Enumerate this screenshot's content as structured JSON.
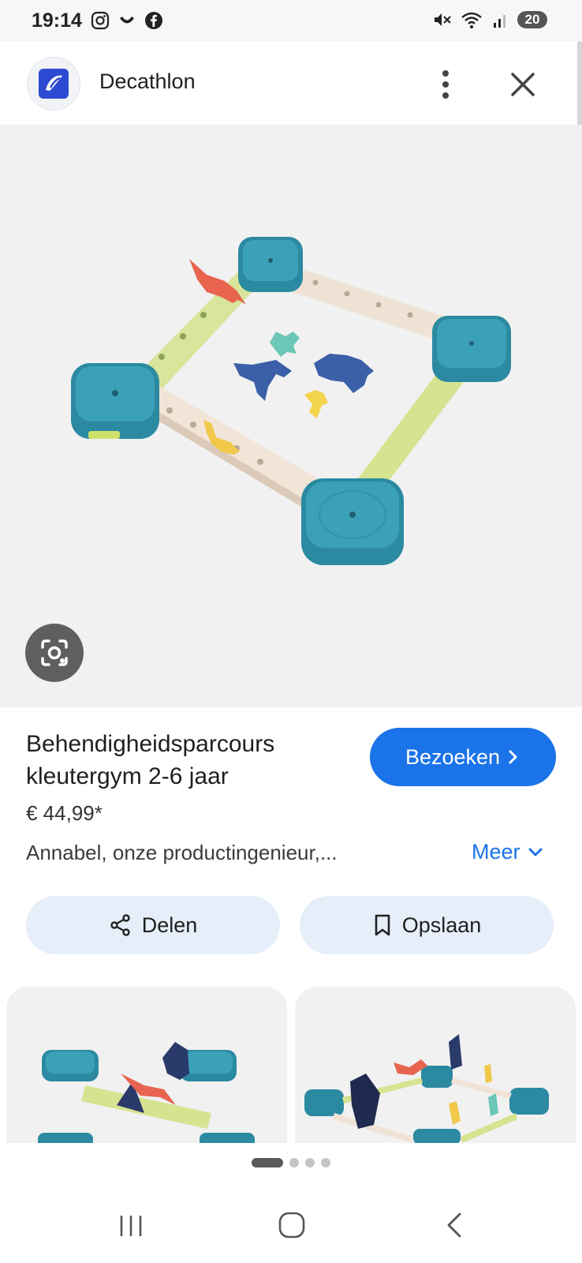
{
  "status_bar": {
    "time": "19:14",
    "app_icons": [
      "instagram-icon",
      "notification-app-icon",
      "facebook-icon"
    ],
    "battery": "20",
    "indicators": [
      "mute-icon",
      "wifi-icon",
      "signal-icon"
    ]
  },
  "header": {
    "brand": "Decathlon",
    "logo_color": "#2d4bd2"
  },
  "product": {
    "title": "Behendigheidsparcours kleutergym 2-6 jaar",
    "price": "€ 44,99*",
    "description": "Annabel, onze productingenieur,...",
    "more_label": "Meer",
    "visit_label": "Bezoeken"
  },
  "actions": {
    "share_label": "Delen",
    "save_label": "Opslaan"
  },
  "pager": {
    "active_index": 0,
    "count": 4
  },
  "colors": {
    "accent": "#1a73e8",
    "pill_bg": "#e6eef9",
    "teal": "#2b8aa1",
    "beige": "#eedfd2",
    "lime": "#d2e08f"
  }
}
